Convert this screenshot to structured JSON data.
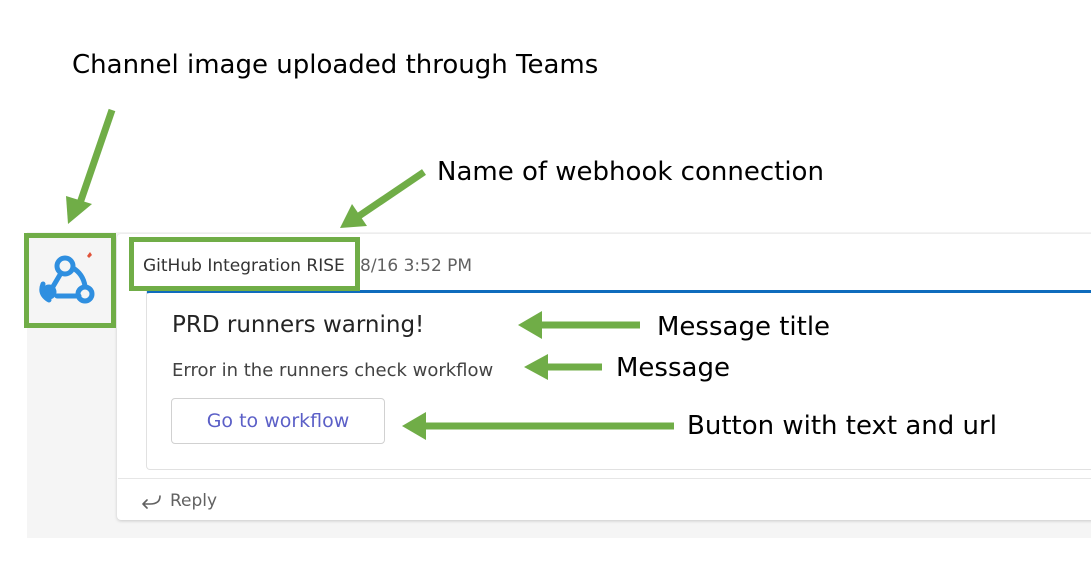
{
  "annotations": {
    "channel_image": "Channel image uploaded through Teams",
    "webhook_name": "Name of webhook connection",
    "message_title": "Message title",
    "message": "Message",
    "button": "Button with text and url"
  },
  "post": {
    "sender": "GitHub Integration RISE",
    "timestamp": "8/16 3:52 PM",
    "avatar_icon": "webhook-icon"
  },
  "card": {
    "title": "PRD runners warning!",
    "message": "Error in the runners check workflow",
    "button_label": "Go to workflow"
  },
  "reply": {
    "label": "Reply",
    "icon": "reply-arrow-icon"
  },
  "colors": {
    "annotation_green": "#70ad47",
    "card_accent": "#0f6cbd",
    "button_text": "#5b5fc7",
    "avatar_blue": "#2f8fe0"
  }
}
